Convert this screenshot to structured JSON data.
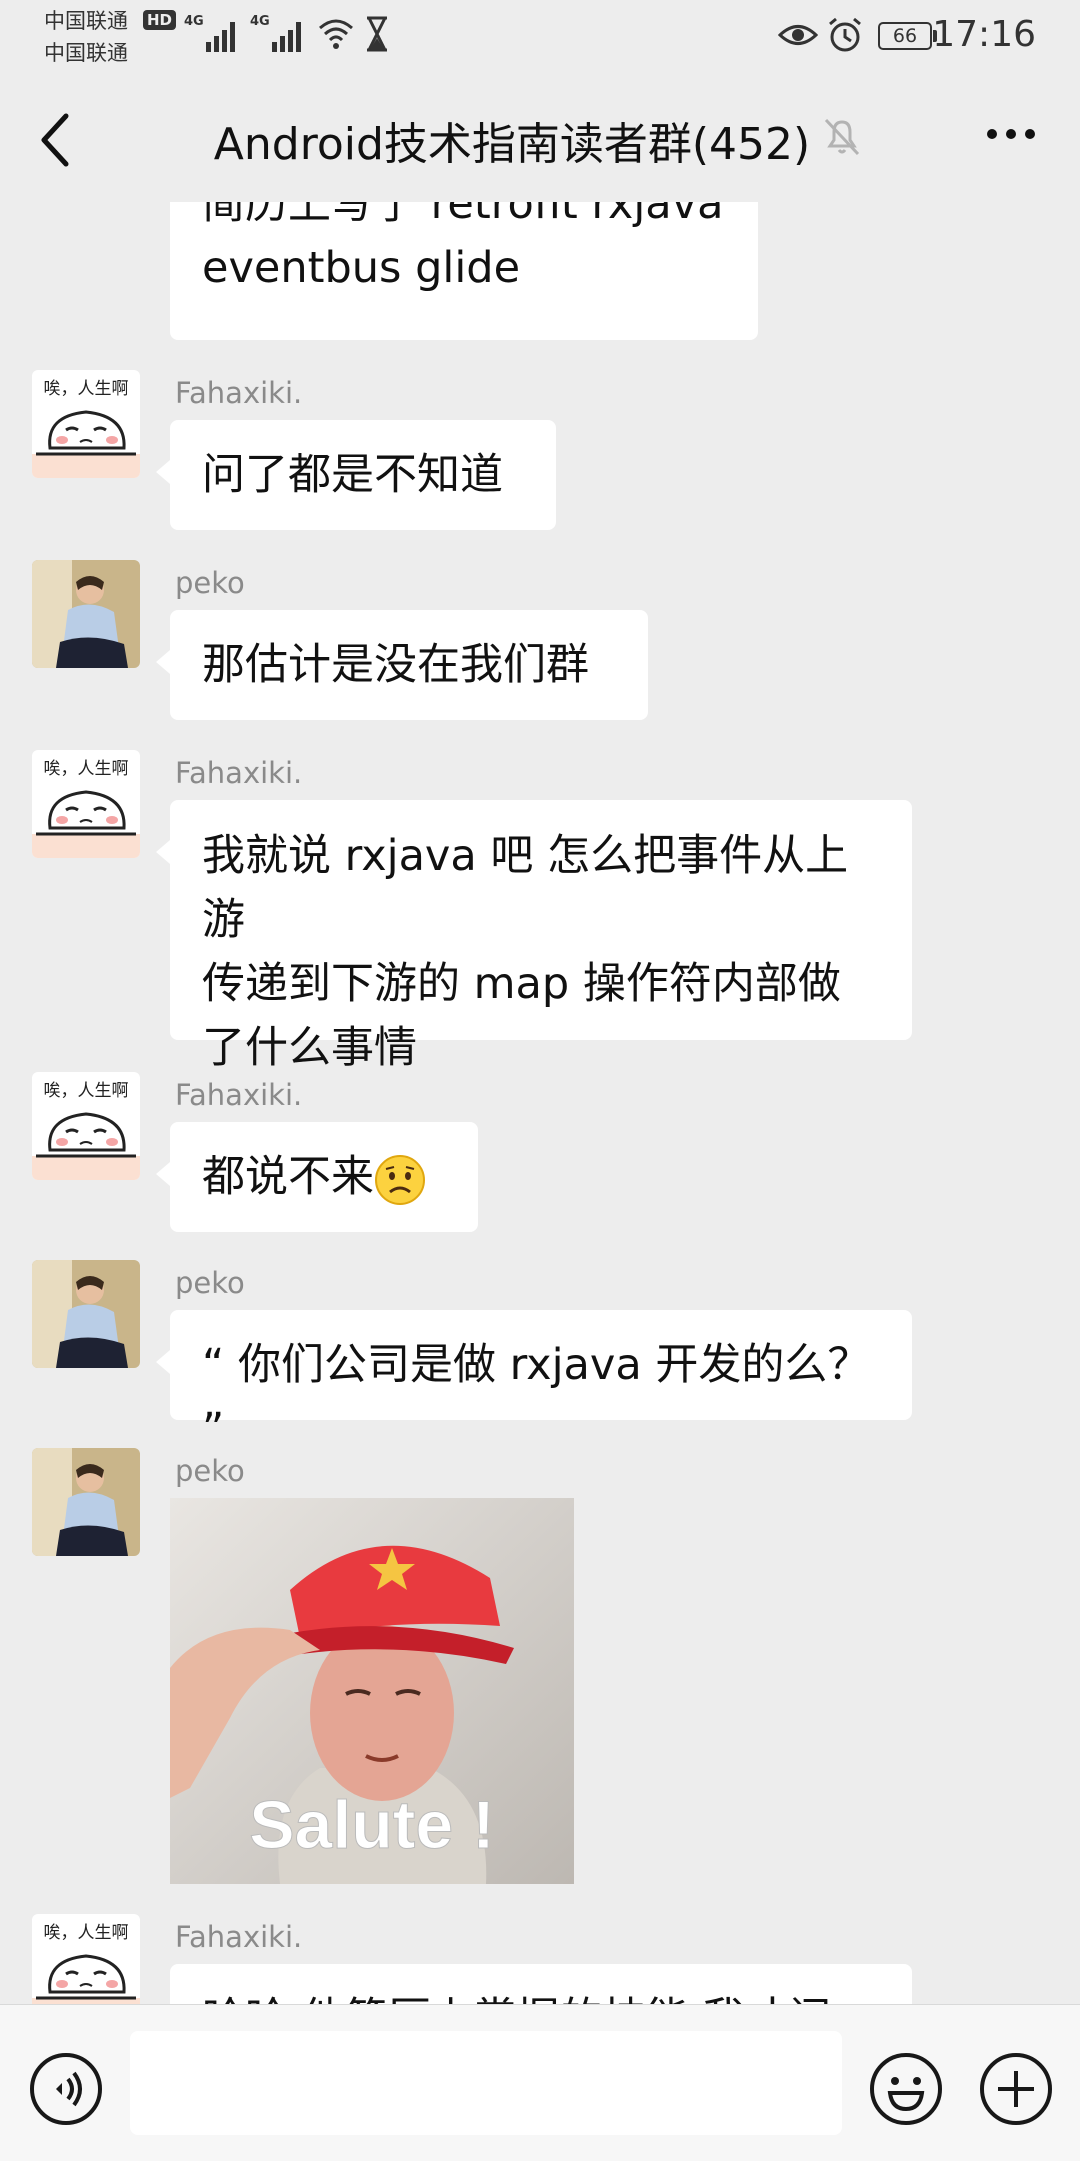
{
  "status_bar": {
    "carrier1": "中国联通",
    "carrier2": "中国联通",
    "hd_badge": "HD",
    "net1": "4G",
    "net2": "4G",
    "battery": "66",
    "time": "17:16"
  },
  "header": {
    "title": "Android技术指南读者群(452)",
    "back_icon": "chevron-left-icon",
    "mute_icon": "bell-off-icon",
    "more_icon": "more-horizontal-icon"
  },
  "messages": [
    {
      "sender": "",
      "lines": [
        "简历上写了 retrofit rxjava",
        "eventbus glide"
      ]
    },
    {
      "sender": "Fahaxiki.",
      "lines": [
        "问了都是不知道"
      ]
    },
    {
      "sender": "peko",
      "lines": [
        "那估计是没在我们群"
      ]
    },
    {
      "sender": "Fahaxiki.",
      "lines": [
        "我就说 rxjava 吧 怎么把事件从上游",
        "传递到下游的 map 操作符内部做",
        "了什么事情"
      ]
    },
    {
      "sender": "Fahaxiki.",
      "lines": [
        "都说不来"
      ]
    },
    {
      "sender": "peko",
      "lines": [
        "“ 你们公司是做 rxjava 开发的么？ ”"
      ]
    },
    {
      "sender": "peko",
      "image_caption": "Salute !"
    },
    {
      "sender": "Fahaxiki.",
      "lines": [
        "哈哈 他简历上掌握的技能 我才问"
      ]
    }
  ],
  "avatar_caption": "唉，人生啊",
  "input_bar": {
    "voice_icon": "voice-icon",
    "emoji_icon": "smile-icon",
    "plus_icon": "plus-circle-icon",
    "placeholder": ""
  },
  "colors": {
    "background": "#ededed",
    "bubble": "#ffffff",
    "sender": "#8a8a8a"
  }
}
